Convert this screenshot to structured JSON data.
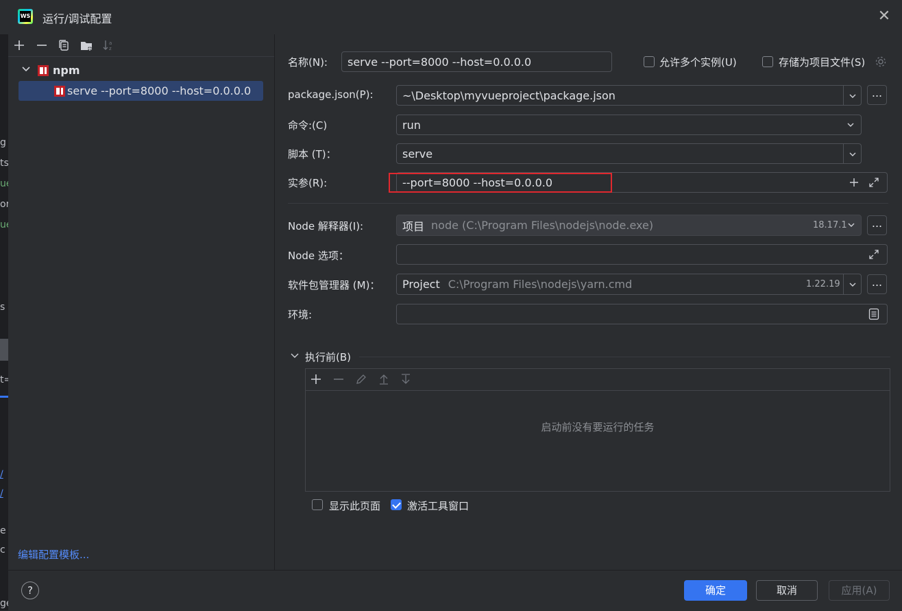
{
  "window": {
    "title": "运行/调试配置",
    "logo_text": "WS"
  },
  "left_panel": {
    "tree": {
      "group_label": "npm",
      "config_label": "serve --port=8000 --host=0.0.0.0"
    },
    "edit_templates_link": "编辑配置模板..."
  },
  "editor_strip": [
    "s",
    "g",
    "ts",
    "ue",
    "or",
    "ue",
    "s",
    "t=",
    "/",
    "/",
    "e",
    "c",
    "ge"
  ],
  "form": {
    "name_label": "名称(N):",
    "name_value": "serve --port=8000 --host=0.0.0.0",
    "allow_multiple_label": "允许多个实例(U)",
    "allow_multiple_checked": false,
    "store_as_file_label": "存储为项目文件(S)",
    "store_as_file_checked": false,
    "package_json_label": "package.json(P):",
    "package_json_value": "~\\Desktop\\myvueproject\\package.json",
    "command_label": "命令:(C)",
    "command_value": "run",
    "scripts_label": "脚本 (T)：",
    "scripts_value": "serve",
    "arguments_label": "实参(R):",
    "arguments_value": "--port=8000 --host=0.0.0.0",
    "node_interpreter_label": "Node 解释器(I):",
    "node_interpreter_prefix": "项目",
    "node_interpreter_value": "node (C:\\Program Files\\nodejs\\node.exe)",
    "node_interpreter_version": "18.17.1",
    "node_options_label": "Node 选项：",
    "node_options_value": "",
    "package_manager_label": "软件包管理器 (M)：",
    "package_manager_prefix": "Project",
    "package_manager_value": "C:\\Program Files\\nodejs\\yarn.cmd",
    "package_manager_version": "1.22.19",
    "environment_label": "环境:",
    "environment_value": "",
    "more_label": "..."
  },
  "before_launch": {
    "title": "执行前(B)",
    "empty_text": "启动前没有要运行的任务"
  },
  "options": {
    "show_page_label": "显示此页面",
    "show_page_checked": false,
    "activate_tool_window_label": "激活工具窗口",
    "activate_tool_window_checked": true
  },
  "buttons": {
    "help": "?",
    "ok": "确定",
    "cancel": "取消",
    "apply": "应用(A)"
  },
  "colors": {
    "background": "#2b2d30",
    "accent": "#3574f0",
    "selection": "#2e436e",
    "highlight_box": "#e0282e",
    "link": "#548af7"
  }
}
